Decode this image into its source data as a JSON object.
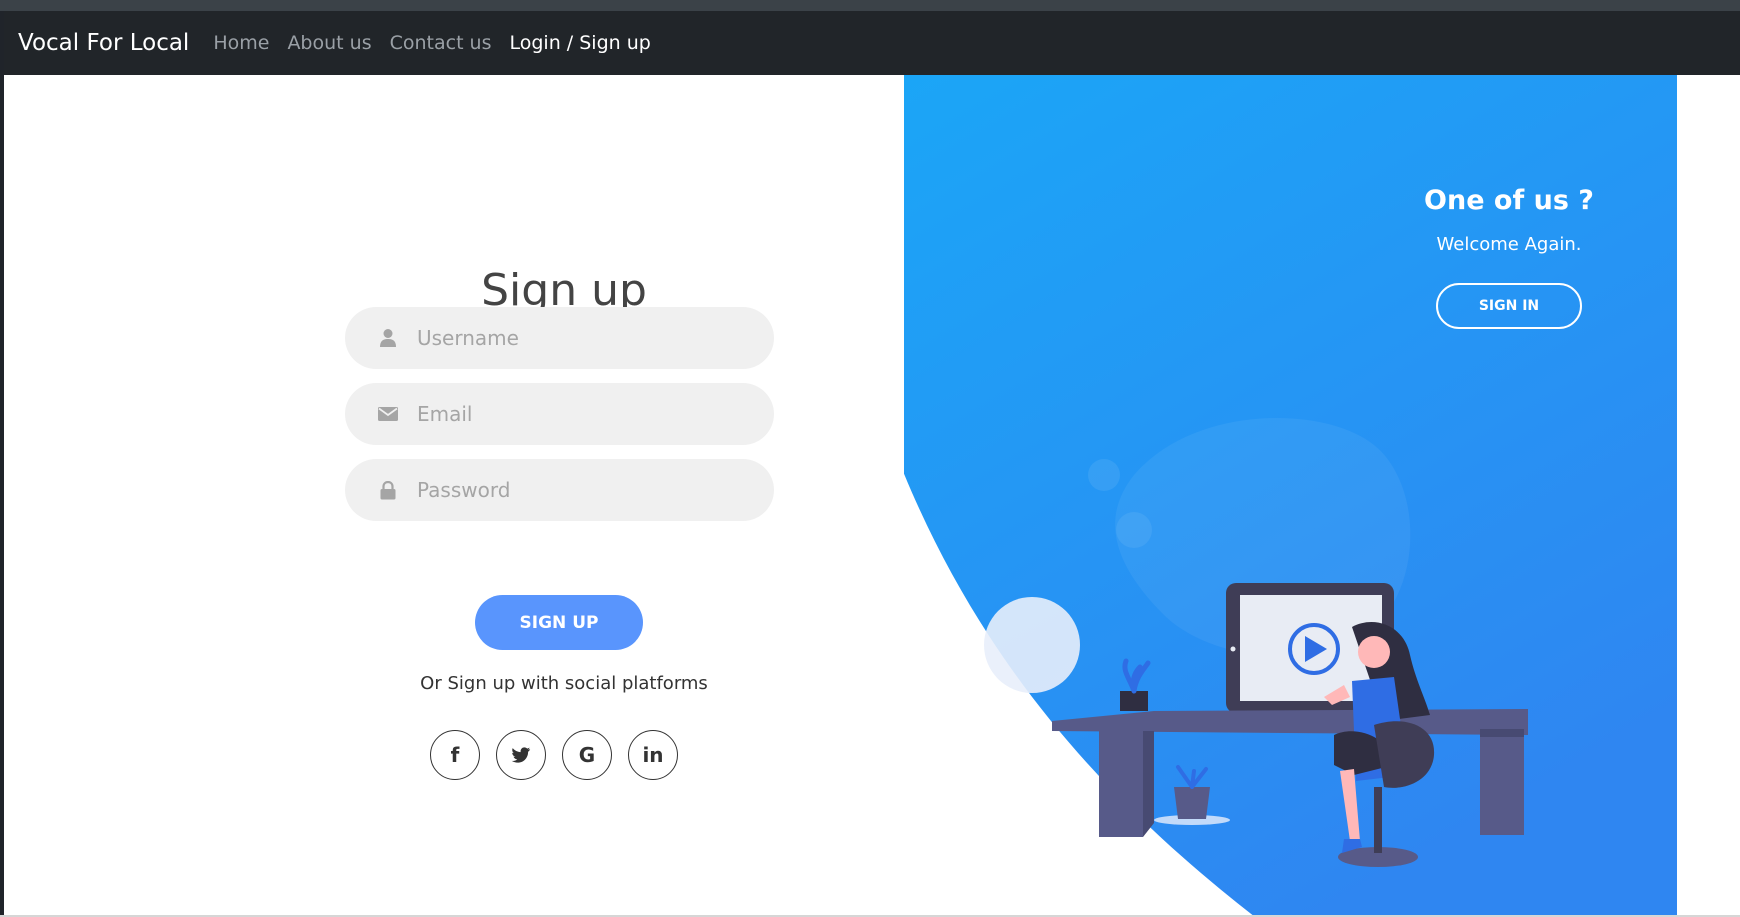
{
  "navbar": {
    "brand": "Vocal For Local",
    "links": [
      {
        "label": "Home"
      },
      {
        "label": "About us"
      },
      {
        "label": "Contact us"
      },
      {
        "label": "Login / Sign up"
      }
    ]
  },
  "form": {
    "title": "Sign up",
    "username_placeholder": "Username",
    "email_placeholder": "Email",
    "password_placeholder": "Password",
    "submit_label": "SIGN UP",
    "social_text": "Or Sign up with social platforms",
    "social": [
      {
        "icon": "facebook-icon",
        "glyph": "f"
      },
      {
        "icon": "twitter-icon"
      },
      {
        "icon": "google-icon",
        "glyph": "G"
      },
      {
        "icon": "linkedin-icon",
        "glyph": "in"
      }
    ]
  },
  "panel": {
    "title": "One of us ?",
    "text": "Welcome Again.",
    "button_label": "SIGN IN"
  },
  "colors": {
    "navbar": "#212529",
    "accent_button": "#5995fd",
    "panel_blue": "#1fa2f5",
    "field_bg": "#f0f0f0"
  }
}
